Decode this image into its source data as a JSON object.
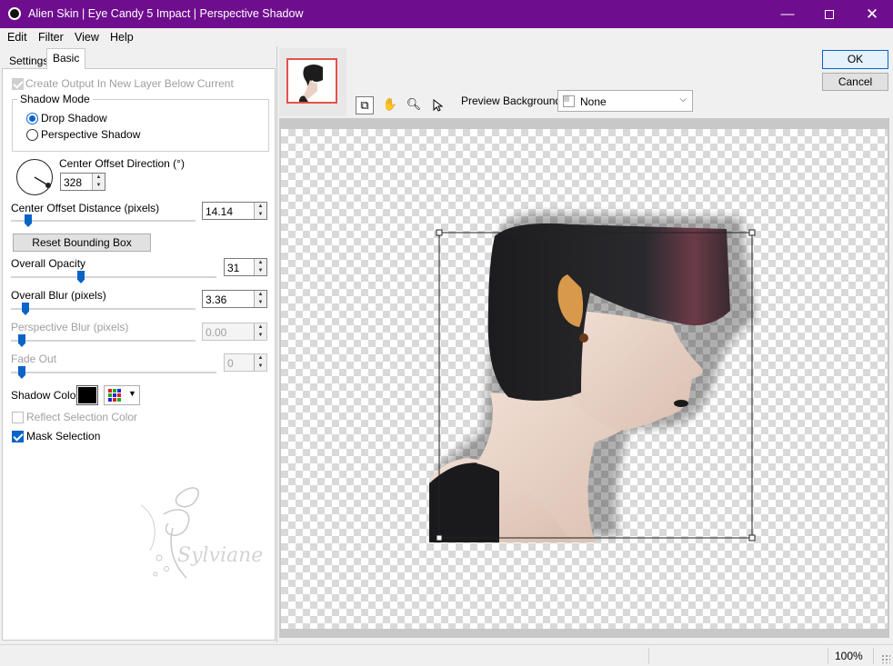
{
  "window": {
    "title": "Alien Skin | Eye Candy 5 Impact | Perspective Shadow",
    "minimize": "—",
    "close": "✕"
  },
  "menu": [
    "Edit",
    "Filter",
    "View",
    "Help"
  ],
  "tabs": [
    "Settings",
    "Basic"
  ],
  "basic": {
    "create_output_label": "Create Output In New Layer Below Current",
    "shadow_mode_label": "Shadow Mode",
    "shadow_mode_options": [
      "Drop Shadow",
      "Perspective Shadow"
    ],
    "shadow_mode_selected": "Drop Shadow",
    "center_offset_direction_label": "Center Offset Direction (°)",
    "center_offset_direction_value": "328",
    "center_offset_distance_label": "Center Offset Distance (pixels)",
    "center_offset_distance_value": "14.14",
    "reset_bounding_box_label": "Reset Bounding Box",
    "overall_opacity_label": "Overall Opacity",
    "overall_opacity_value": "31",
    "overall_blur_label": "Overall Blur (pixels)",
    "overall_blur_value": "3.36",
    "perspective_blur_label": "Perspective Blur (pixels)",
    "perspective_blur_value": "0.00",
    "fade_out_label": "Fade Out",
    "fade_out_value": "0",
    "shadow_color_label": "Shadow Color",
    "shadow_color": "#000000",
    "reflect_selection_color_label": "Reflect Selection Color",
    "mask_selection_label": "Mask Selection",
    "mask_selection_checked": true
  },
  "sliders": {
    "center_offset_distance": 0.09,
    "overall_opacity": 0.31,
    "overall_blur": 0.03,
    "perspective_blur": 0.0,
    "fade_out": 0.0
  },
  "watermark_text": "Sylviane",
  "buttons": {
    "ok": "OK",
    "cancel": "Cancel"
  },
  "preview": {
    "background_label": "Preview Background:",
    "background_value": "None",
    "tools": [
      "preview-toggle-icon",
      "hand-icon",
      "zoom-icon",
      "pointer-icon"
    ]
  },
  "status": {
    "zoom": "100%"
  },
  "colors": {
    "titlebar": "#6f0d8f",
    "accent": "#0a64c8",
    "thumbnail_border": "#e5504a"
  }
}
